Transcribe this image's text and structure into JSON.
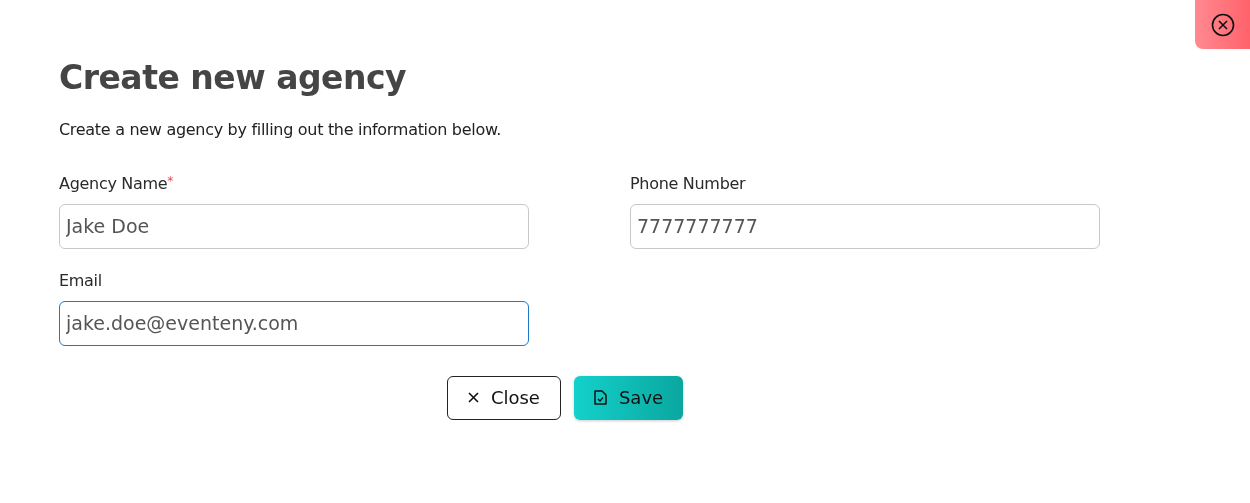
{
  "dialog": {
    "title": "Create new agency",
    "subtitle": "Create a new agency by filling out the information below.",
    "fields": [
      {
        "label": "Agency Name",
        "required_mark": "*",
        "value": "Jake Doe",
        "focused": false
      },
      {
        "label": "Phone Number",
        "value": "7777777777",
        "focused": false
      },
      {
        "label": "Email",
        "value": "jake.doe@eventeny.com",
        "focused": true
      }
    ],
    "buttons": [
      {
        "kind": "close",
        "label": "Close"
      },
      {
        "kind": "save",
        "label": "Save"
      }
    ]
  }
}
